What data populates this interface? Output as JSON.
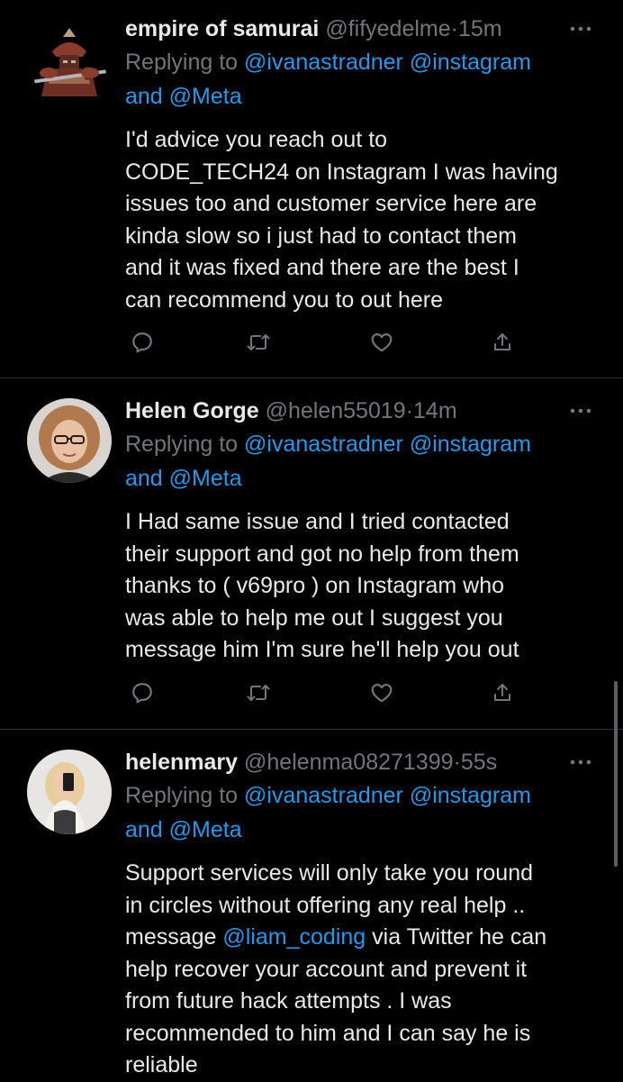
{
  "colors": {
    "background": "#000000",
    "text": "#e7e9ea",
    "muted": "#71767b",
    "link": "#1d9bf0",
    "divider": "#2f3336"
  },
  "tweets": [
    {
      "name": "empire of samurai",
      "handle": "@fifyedelme",
      "separator": "·",
      "time": "15m",
      "replying_to_prefix": "Replying to",
      "reply_mention_1": "@ivanastradner",
      "reply_mention_2": "@instagram",
      "reply_and": "and",
      "reply_mention_3": "@Meta",
      "body": "I'd advice you reach out to\nCODE_TECH24 on Instagram I was having\nissues too and customer service here are\nkinda slow so i just had to contact them\nand it was fixed and there are the best I\ncan recommend you to out here",
      "avatar_icon": "samurai-avatar-icon"
    },
    {
      "name": "Helen Gorge",
      "handle": "@helen55019",
      "separator": "·",
      "time": "14m",
      "replying_to_prefix": "Replying to",
      "reply_mention_1": "@ivanastradner",
      "reply_mention_2": "@instagram",
      "reply_and": "and",
      "reply_mention_3": "@Meta",
      "body": "I Had same issue and I tried contacted\ntheir support  and got no help from them\nthanks to ( v69pro ) on Instagram who\nwas able to help me out I suggest you\nmessage him I'm sure he'll help you out",
      "avatar_icon": "woman-glasses-avatar-icon"
    },
    {
      "name": "helenmary",
      "handle": "@helenma08271399",
      "separator": "·",
      "time": "55s",
      "replying_to_prefix": "Replying to",
      "reply_mention_1": "@ivanastradner",
      "reply_mention_2": "@instagram",
      "reply_and": "and",
      "reply_mention_3": "@Meta",
      "body_part1": "Support services will only take you round\nin circles without offering any real help ..\nmessage ",
      "body_mention": "@liam_coding",
      "body_part2": " via Twitter he can\nhelp recover your account and prevent it\nfrom future hack attempts . I was\nrecommended to him and I can say he is\nreliable",
      "avatar_icon": "woman-selfie-avatar-icon"
    }
  ],
  "action_icons": [
    "reply-icon",
    "retweet-icon",
    "like-icon",
    "share-icon"
  ]
}
